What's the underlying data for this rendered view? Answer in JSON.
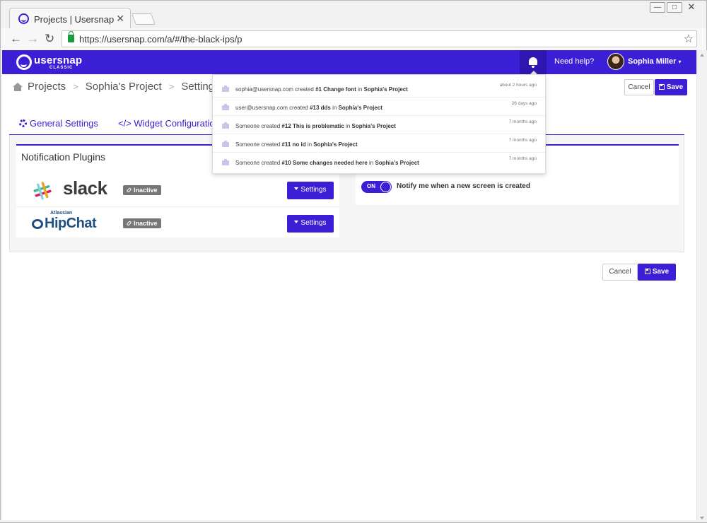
{
  "browser": {
    "tab_title": "Projects | Usersnap",
    "tab_close": "✕",
    "url": "https://usersnap.com/a/#/the-black-ips/p",
    "window_buttons": [
      "—",
      "□",
      "✕"
    ]
  },
  "appbar": {
    "logo_main": "usersnap",
    "logo_sub": "CLASSIC",
    "help": "Need help?",
    "user": "Sophia Miller"
  },
  "breadcrumb": {
    "items": [
      "Projects",
      "Sophia's Project",
      "Setting"
    ],
    "separator": ">"
  },
  "actions": {
    "cancel": "Cancel",
    "save": "Save"
  },
  "tabs": {
    "general": "General Settings",
    "widget": "</> Widget Configuratio"
  },
  "plugins": {
    "title": "Notification Plugins",
    "items": [
      {
        "name": "slack",
        "status": "Inactive",
        "button": "Settings"
      },
      {
        "name": "HipChat",
        "brand_top": "Atlassian",
        "status": "Inactive",
        "button": "Settings"
      }
    ]
  },
  "notify": {
    "toggle": "ON",
    "label": "Notify me when a new screen is created"
  },
  "notifications": [
    {
      "who": "sophia@usersnap.com created ",
      "item": "#1 Change font",
      "in": " in ",
      "project": "Sophia's Project",
      "time": "about 2 hours ago"
    },
    {
      "who": "user@usersnap.com created ",
      "item": "#13 dds",
      "in": " in ",
      "project": "Sophia's Project",
      "time": "26 days ago"
    },
    {
      "who": "Someone created ",
      "item": "#12 This is problematic",
      "in": " in ",
      "project": "Sophia's Project",
      "time": "7 months ago"
    },
    {
      "who": "Someone created ",
      "item": "#11 no id",
      "in": " in ",
      "project": "Sophia's Project",
      "time": "7 months ago"
    },
    {
      "who": "Someone created ",
      "item": "#10 Some changes needed here",
      "in": " in ",
      "project": "Sophia's Project",
      "time": "7 months ago"
    }
  ],
  "colors": {
    "brand": "#3b1fd6",
    "badge": "#777777"
  },
  "icons": [
    "home-icon",
    "bell-icon",
    "gear-icon",
    "camera-icon",
    "link-icon",
    "save-icon",
    "star-icon",
    "lock-icon"
  ]
}
